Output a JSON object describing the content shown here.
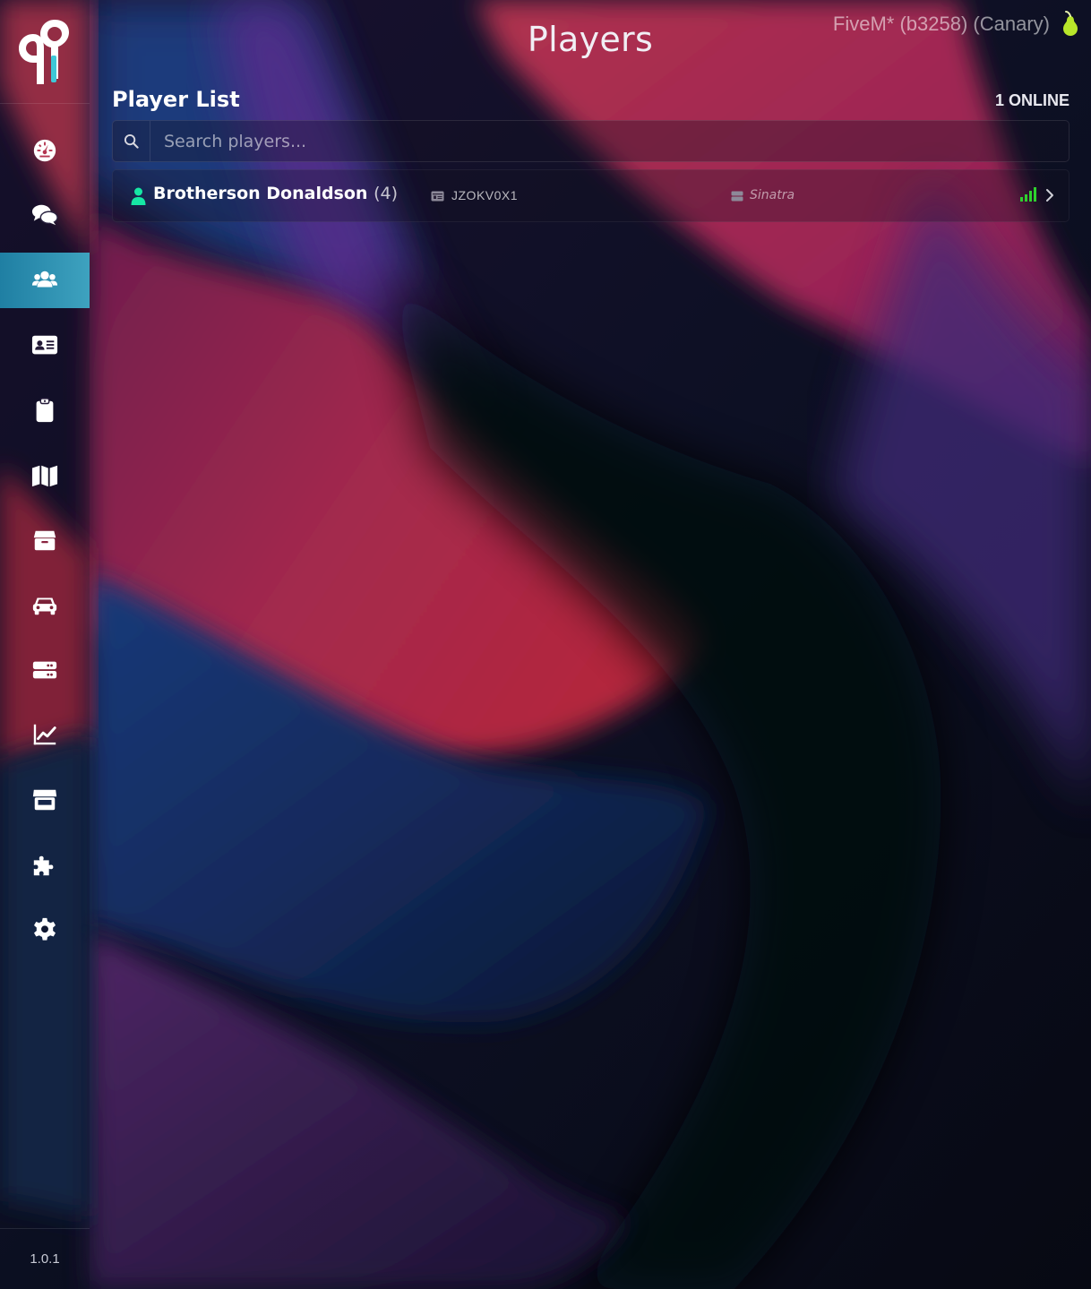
{
  "app": {
    "page_title": "Players",
    "server_build": "FiveM* (b3258) (Canary)",
    "version": "1.0.1"
  },
  "sidebar": {
    "items": [
      {
        "icon": "dashboard-gauge-icon",
        "active": false
      },
      {
        "icon": "chat-icon",
        "active": false
      },
      {
        "icon": "users-icon",
        "active": true
      },
      {
        "icon": "id-card-icon",
        "active": false
      },
      {
        "icon": "clipboard-icon",
        "active": false
      },
      {
        "icon": "map-icon",
        "active": false
      },
      {
        "icon": "box-icon",
        "active": false
      },
      {
        "icon": "car-icon",
        "active": false
      },
      {
        "icon": "server-icon",
        "active": false
      },
      {
        "icon": "chart-line-icon",
        "active": false
      },
      {
        "icon": "store-icon",
        "active": false
      },
      {
        "icon": "puzzle-icon",
        "active": false
      },
      {
        "icon": "gear-icon",
        "active": false
      }
    ]
  },
  "player_list": {
    "title": "Player List",
    "online_count": "1 ONLINE",
    "search_placeholder": "Search players...",
    "players": [
      {
        "name": "Brotherson Donaldson",
        "id": "(4)",
        "citizen_id": "JZOKV0X1",
        "job": "Sinatra",
        "status_color": "#16e6a4",
        "signal_color": "#2ed12e"
      }
    ]
  },
  "colors": {
    "accent_active": "#2f93b5",
    "online_green": "#16e6a4",
    "pear_green": "#b8e62a"
  }
}
